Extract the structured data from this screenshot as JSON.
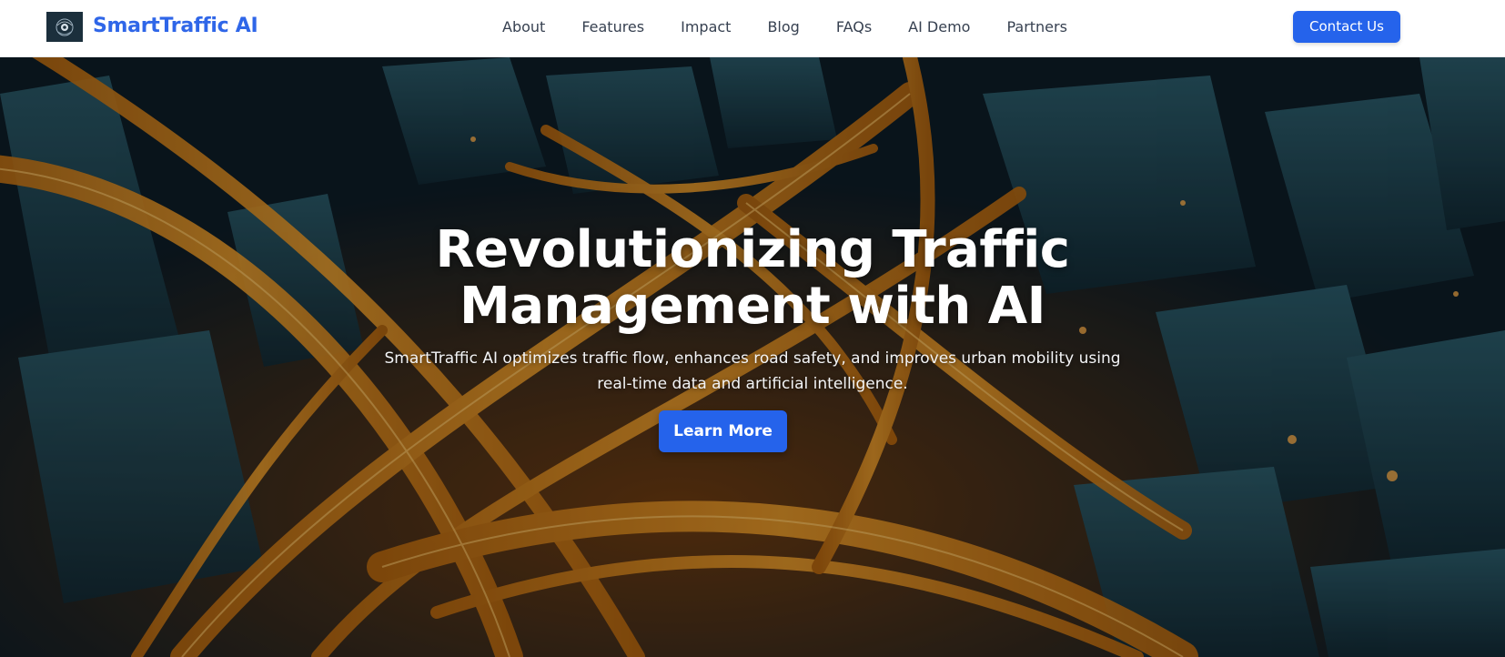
{
  "navbar": {
    "brand": "SmartTraffic AI",
    "logo_icon": "traffic-circle-logo",
    "links": [
      "About",
      "Features",
      "Impact",
      "Blog",
      "FAQs",
      "AI Demo",
      "Partners"
    ],
    "contact_label": "Contact Us"
  },
  "hero": {
    "title": "Revolutionizing Traffic Management with AI",
    "subtitle": "SmartTraffic AI optimizes traffic flow, enhances road safety, and improves urban mobility using real-time data and artificial intelligence.",
    "cta_label": "Learn More",
    "background_image": "aerial city highway interchange at night"
  },
  "colors": {
    "brand": "#2f66e8",
    "button": "#2563eb",
    "nav_text": "#374151"
  }
}
